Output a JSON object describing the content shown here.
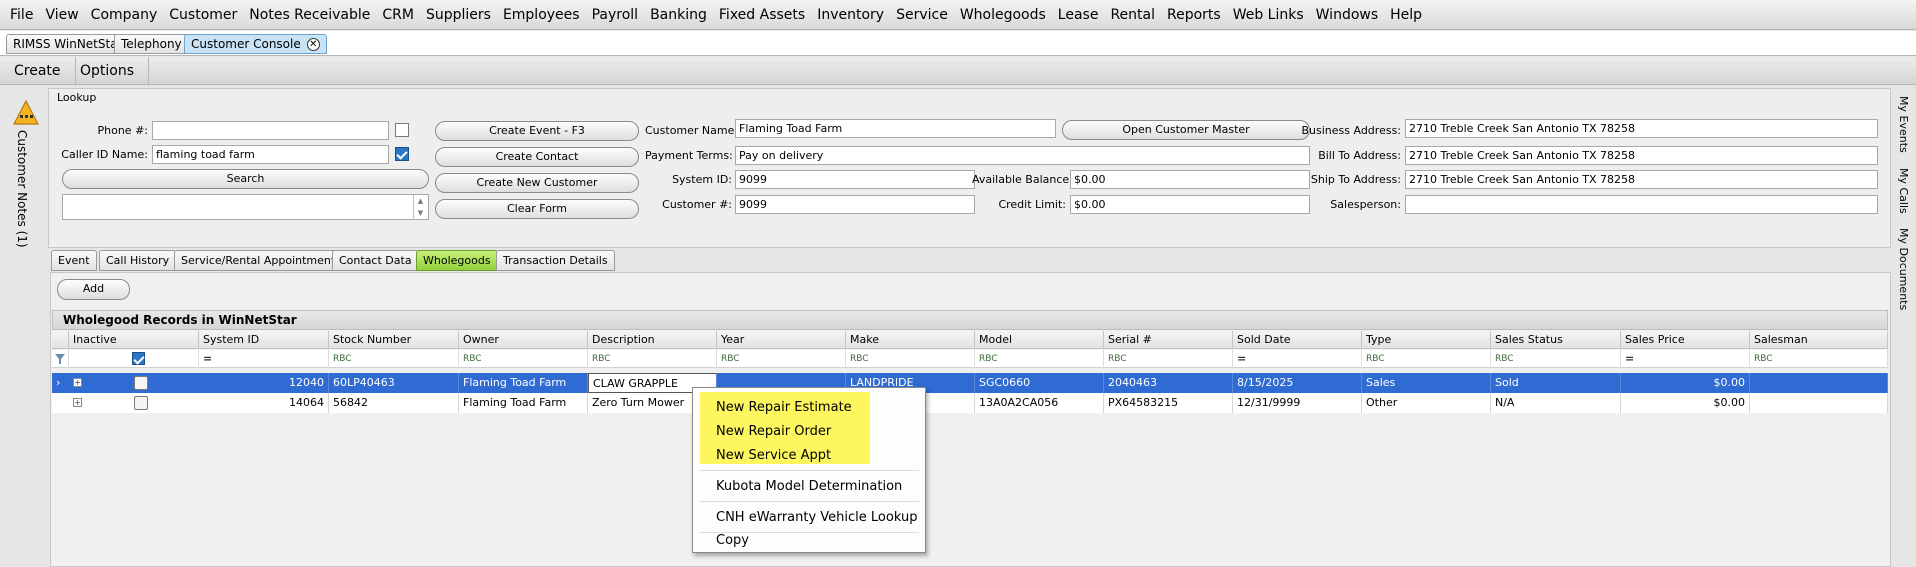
{
  "menu": [
    "File",
    "View",
    "Company",
    "Customer",
    "Notes Receivable",
    "CRM",
    "Suppliers",
    "Employees",
    "Payroll",
    "Banking",
    "Fixed Assets",
    "Inventory",
    "Service",
    "Wholegoods",
    "Lease",
    "Rental",
    "Reports",
    "Web Links",
    "Windows",
    "Help"
  ],
  "doc_tabs": [
    "RIMSS WinNetStar",
    "Telephony",
    "Customer Console"
  ],
  "commands": [
    "Create",
    "Options"
  ],
  "side_left": "Customer Notes (1)",
  "side_right": [
    "My Events",
    "My Calls",
    "My Documents"
  ],
  "lookup": {
    "title": "Lookup",
    "phone_label": "Phone #:",
    "phone_value": "",
    "callerid_label": "Caller ID Name:",
    "callerid_value": "flaming toad farm",
    "search_button": "Search",
    "create_event_button": "Create Event - F3",
    "create_contact_button": "Create Contact",
    "create_customer_button": "Create New Customer",
    "clear_form_button": "Clear Form",
    "customer_name_label": "Customer Name:",
    "customer_name": "Flaming Toad Farm",
    "open_master_button": "Open Customer Master",
    "payment_terms_label": "Payment Terms:",
    "payment_terms": "Pay on delivery",
    "system_id_label": "System ID:",
    "system_id": "9099",
    "customer_no_label": "Customer #:",
    "customer_no": "9099",
    "available_balance_label": "Available Balance:",
    "available_balance": "$0.00",
    "credit_limit_label": "Credit Limit:",
    "credit_limit": "$0.00",
    "business_address_label": "Business Address:",
    "business_address": "2710 Treble Creek San Antonio TX 78258",
    "bill_to_label": "Bill To Address:",
    "bill_to": "2710 Treble Creek San Antonio TX 78258",
    "ship_to_label": "Ship To Address:",
    "ship_to": "2710 Treble Creek San Antonio TX 78258",
    "salesperson_label": "Salesperson:",
    "salesperson": ""
  },
  "sub_tabs": [
    "Event",
    "Call History",
    "Service/Rental Appointments",
    "Contact Data",
    "Wholegoods",
    "Transaction Details"
  ],
  "add_button": "Add",
  "grid": {
    "title": "Wholegood Records in WinNetStar",
    "columns": [
      "Inactive",
      "System ID",
      "Stock Number",
      "Owner",
      "Description",
      "Year",
      "Make",
      "Model",
      "Serial #",
      "Sold Date",
      "Type",
      "Sales Status",
      "Sales Price",
      "Salesman"
    ],
    "filters": [
      "",
      "=",
      "RBC",
      "RBC",
      "RBC",
      "RBC",
      "RBC",
      "RBC",
      "RBC",
      "=",
      "RBC",
      "RBC",
      "=",
      "RBC"
    ],
    "rows": [
      {
        "system_id": "12040",
        "stock": "60LP40463",
        "owner": "Flaming Toad Farm",
        "description": "CLAW GRAPPLE",
        "year": "",
        "make": "LANDPRIDE",
        "model": "SGC0660",
        "serial": "2040463",
        "sold_date": "8/15/2025",
        "type": "Sales",
        "status": "Sold",
        "price": "$0.00",
        "salesman": ""
      },
      {
        "system_id": "14064",
        "stock": "56842",
        "owner": "Flaming Toad Farm",
        "description": "Zero Turn Mower",
        "year": "",
        "make": "",
        "model": "13A0A2CA056",
        "serial": "PX64583215",
        "sold_date": "12/31/9999",
        "type": "Other",
        "status": "N/A",
        "price": "$0.00",
        "salesman": ""
      }
    ]
  },
  "context_menu": {
    "items": [
      "New Repair Estimate",
      "New Repair Order",
      "New Service Appt",
      "Kubota Model Determination",
      "CNH eWarranty Vehicle Lookup",
      "Copy"
    ],
    "highlight_color": "#fdf65f"
  }
}
